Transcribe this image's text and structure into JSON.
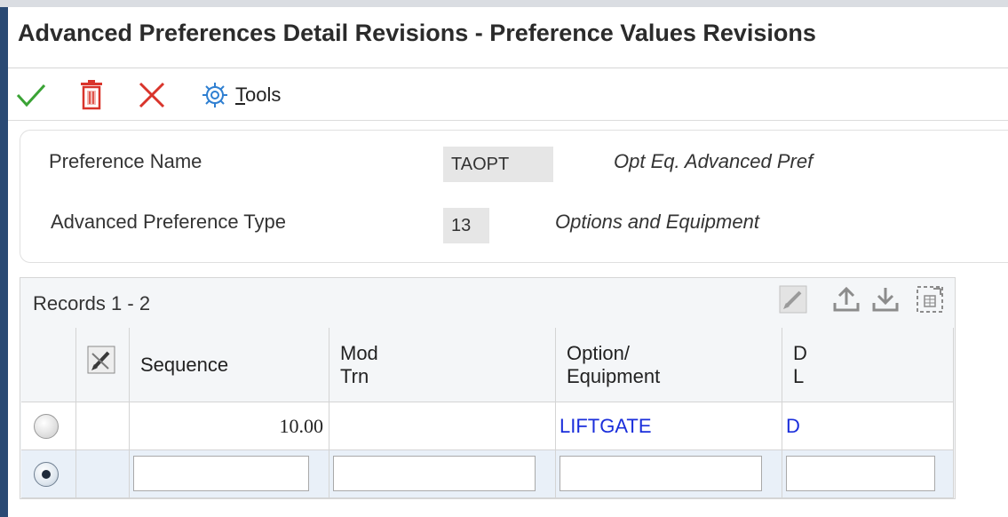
{
  "title": "Advanced Preferences Detail Revisions - Preference Values Revisions",
  "toolbar": {
    "ok_icon": "checkmark-icon",
    "delete_icon": "trash-icon",
    "cancel_icon": "close-icon",
    "tools_icon": "gear-icon",
    "tools_label_mnemonic": "T",
    "tools_label_rest": "ools"
  },
  "header": {
    "preference_name_label": "Preference Name",
    "preference_name_value": "TAOPT",
    "preference_name_desc": "Opt Eq. Advanced Pref",
    "preference_type_label": "Advanced Preference Type",
    "preference_type_value": "13",
    "preference_type_desc": "Options and Equipment"
  },
  "grid": {
    "records_label": "Records 1 - 2",
    "columns": {
      "sequence": "Sequence",
      "mod_trn": "Mod\nTrn",
      "option_equipment": "Option/\nEquipment",
      "dl": "D\nL"
    },
    "rows": [
      {
        "selected": false,
        "sequence": "10.00",
        "mod_trn": "",
        "option_equipment": "LIFTGATE",
        "dl": "D"
      },
      {
        "selected": true,
        "sequence": "",
        "mod_trn": "",
        "option_equipment": "",
        "dl": ""
      }
    ]
  },
  "colors": {
    "accent_navy": "#2a4a74",
    "link_blue": "#1a2edb",
    "ok_green": "#3aa335",
    "delete_red": "#d9342b",
    "selected_row": "#e9f0f8"
  }
}
